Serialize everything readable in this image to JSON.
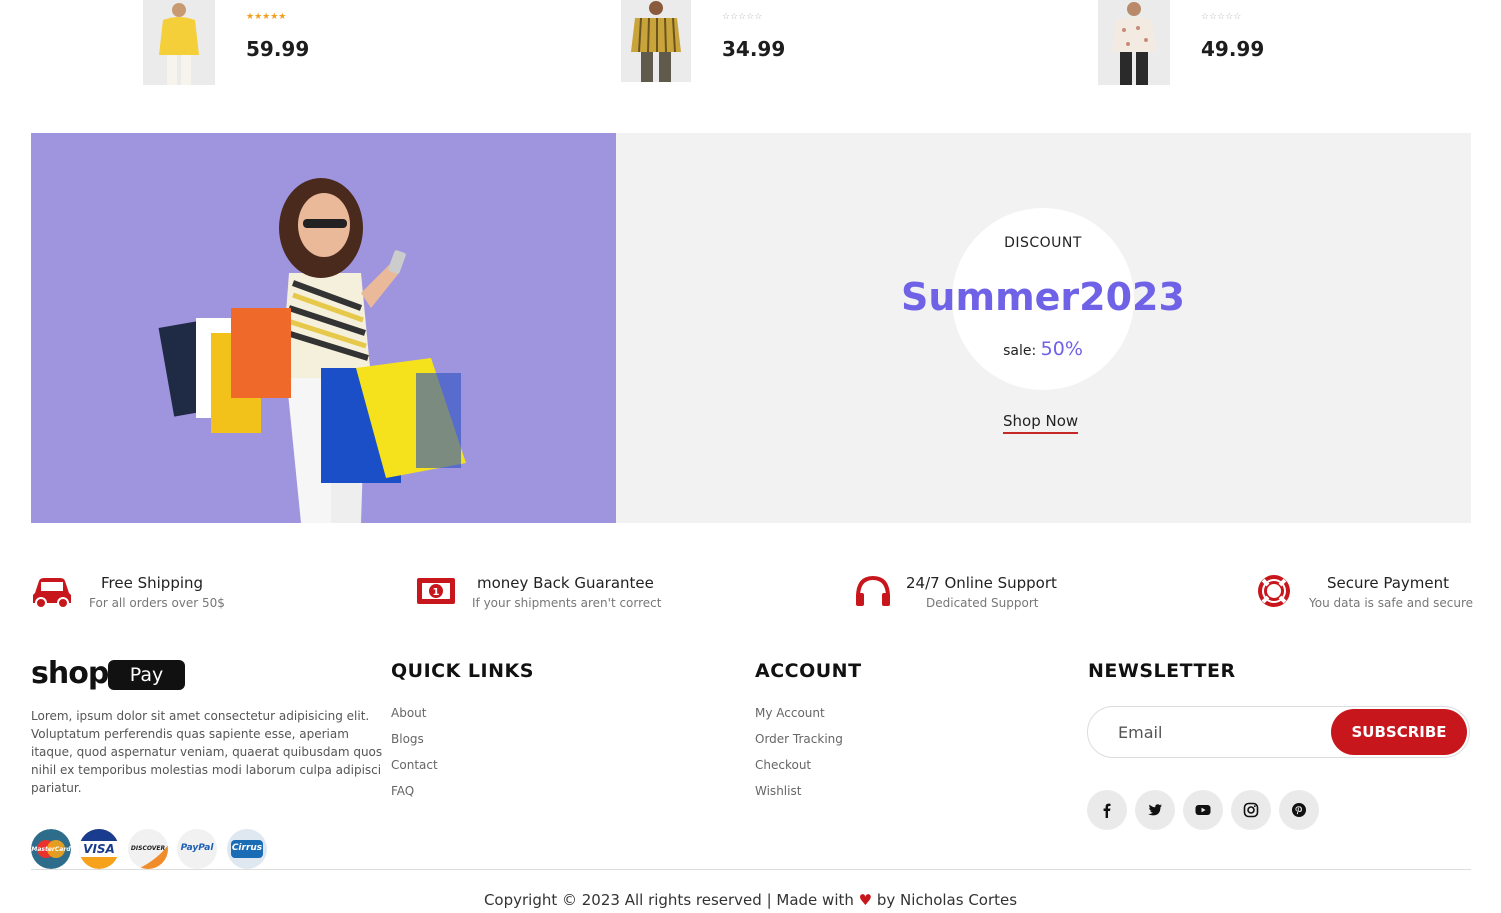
{
  "products": [
    {
      "price": "59.99",
      "stars": "★★★★★",
      "rating_style": "filled"
    },
    {
      "price": "34.99",
      "stars": "☆☆☆☆☆",
      "rating_style": "empty"
    },
    {
      "price": "49.99",
      "stars": "☆☆☆☆☆",
      "rating_style": "empty"
    }
  ],
  "banner": {
    "discount_label": "DISCOUNT",
    "code": "Summer2023",
    "sale_label": "sale:",
    "sale_value": "50%",
    "cta": "Shop Now",
    "hero_bg": "#9e95de",
    "accent": "#6f62e6"
  },
  "features": [
    {
      "icon": "car-icon",
      "title": "Free Shipping",
      "subtitle": "For all orders over 50$"
    },
    {
      "icon": "money-icon",
      "title": "money Back Guarantee",
      "subtitle": "If your shipments aren't correct"
    },
    {
      "icon": "headphones-icon",
      "title": "24/7 Online Support",
      "subtitle": "Dedicated Support"
    },
    {
      "icon": "lifebuoy-icon",
      "title": "Secure Payment",
      "subtitle": "You data is safe and secure"
    }
  ],
  "footer": {
    "logo_word": "shop",
    "logo_pill": "Pay",
    "about": "Lorem, ipsum dolor sit amet consectetur adipisicing elit. Voluptatum perferendis quas sapiente esse, aperiam itaque, quod aspernatur veniam, quaerat quibusdam quos nihil ex temporibus molestias modi laborum culpa adipisci pariatur.",
    "quick_links": {
      "title": "QUICK LINKS",
      "items": [
        "About",
        "Blogs",
        "Contact",
        "FAQ"
      ]
    },
    "account": {
      "title": "ACCOUNT",
      "items": [
        "My Account",
        "Order Tracking",
        "Checkout",
        "Wishlist"
      ]
    },
    "newsletter": {
      "title": "NEWSLETTER",
      "placeholder": "Email",
      "button": "SUBSCRIBE"
    },
    "social": [
      "facebook-icon",
      "twitter-icon",
      "youtube-icon",
      "instagram-icon",
      "pinterest-icon"
    ],
    "payments": [
      {
        "name": "mastercard-icon",
        "label": "MasterCard"
      },
      {
        "name": "visa-icon",
        "label": "VISA"
      },
      {
        "name": "discover-icon",
        "label": "DISCOVER"
      },
      {
        "name": "paypal-icon",
        "label": "PayPal"
      },
      {
        "name": "cirrus-icon",
        "label": "Cirrus"
      }
    ],
    "copyright_pre": "Copyright © 2023 All rights reserved | Made with",
    "heart": "♥",
    "copyright_post": "by Nicholas Cortes",
    "brand_red": "#c8161d"
  }
}
